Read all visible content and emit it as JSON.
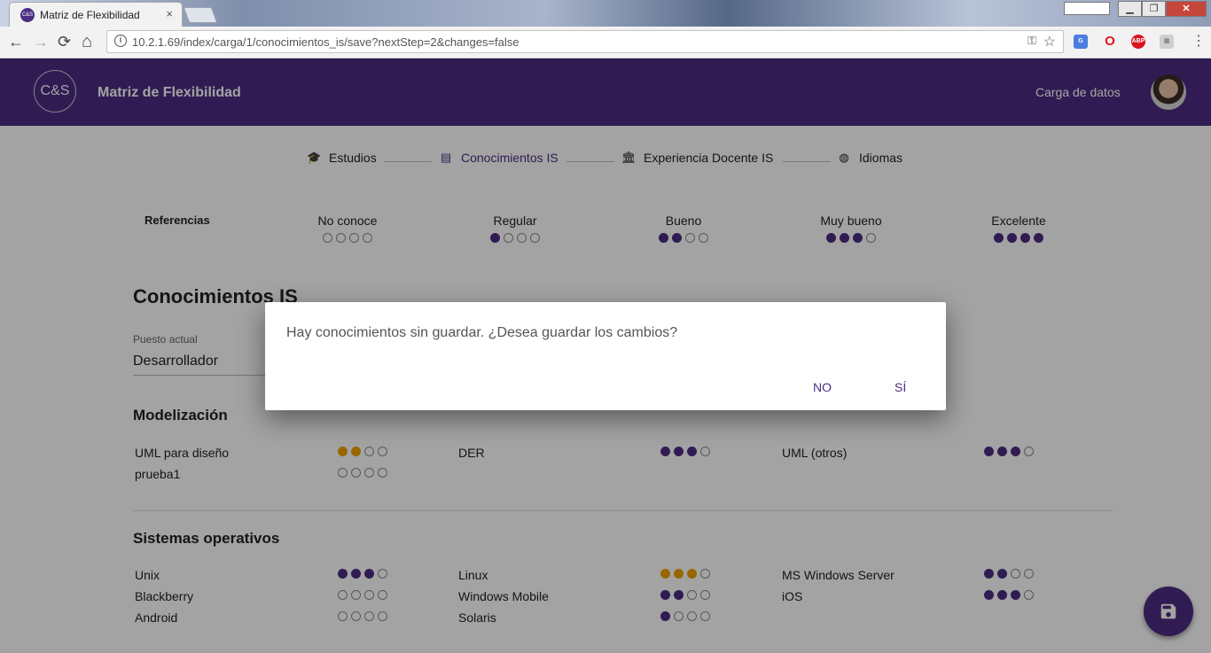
{
  "browser": {
    "tab_title": "Matriz de Flexibilidad",
    "tab_close": "×",
    "url": "10.2.1.69/index/carga/1/conocimientos_is/save?nextStep=2&changes=false",
    "window_minimize": "▁",
    "window_maximize": "❐",
    "window_close": "✕",
    "nav_back": "←",
    "nav_forward": "→",
    "nav_reload": "⟳",
    "nav_home": "⌂",
    "extensions": [
      "translate-icon",
      "opera-icon",
      "adblock-plus-icon",
      "extension-icon"
    ],
    "abp_label": "ABP",
    "favicon_label": "C&S"
  },
  "appbar": {
    "logo": "C&S",
    "title": "Matriz de Flexibilidad",
    "carga_link": "Carga de datos"
  },
  "stepper": {
    "steps": [
      {
        "label": "Estudios",
        "icon": "graduation-cap-icon",
        "glyph": "🎓"
      },
      {
        "label": "Conocimientos IS",
        "icon": "message-icon",
        "glyph": "▤"
      },
      {
        "label": "Experiencia Docente IS",
        "icon": "institution-icon",
        "glyph": "🏛"
      },
      {
        "label": "Idiomas",
        "icon": "globe-icon",
        "glyph": "◍"
      }
    ]
  },
  "references": {
    "label": "Referencias",
    "levels": [
      {
        "label": "No conoce",
        "level": 0
      },
      {
        "label": "Regular",
        "level": 1
      },
      {
        "label": "Bueno",
        "level": 2
      },
      {
        "label": "Muy bueno",
        "level": 3
      },
      {
        "label": "Excelente",
        "level": 4
      }
    ]
  },
  "page": {
    "title": "Conocimientos IS",
    "puesto_label": "Puesto actual",
    "puesto_value": "Desarrollador"
  },
  "sections": [
    {
      "title": "Modelización",
      "skills": [
        {
          "name": "UML para diseño",
          "level": 2,
          "changed": true
        },
        {
          "name": "DER",
          "level": 3,
          "changed": false
        },
        {
          "name": "UML (otros)",
          "level": 3,
          "changed": false
        },
        {
          "name": "prueba1",
          "level": 0,
          "changed": false
        }
      ]
    },
    {
      "title": "Sistemas operativos",
      "skills": [
        {
          "name": "Unix",
          "level": 3,
          "changed": false
        },
        {
          "name": "Linux",
          "level": 3,
          "changed": true
        },
        {
          "name": "MS Windows Server",
          "level": 2,
          "changed": false
        },
        {
          "name": "Blackberry",
          "level": 0,
          "changed": false
        },
        {
          "name": "Windows Mobile",
          "level": 2,
          "changed": false
        },
        {
          "name": "iOS",
          "level": 3,
          "changed": false
        },
        {
          "name": "Android",
          "level": 0,
          "changed": false
        },
        {
          "name": "Solaris",
          "level": 1,
          "changed": false
        }
      ]
    }
  ],
  "dialog": {
    "message": "Hay conocimientos sin guardar. ¿Desea guardar los cambios?",
    "no_label": "NO",
    "yes_label": "SÍ"
  },
  "colors": {
    "primary": "#4b2d82",
    "changed": "#f0a000"
  }
}
